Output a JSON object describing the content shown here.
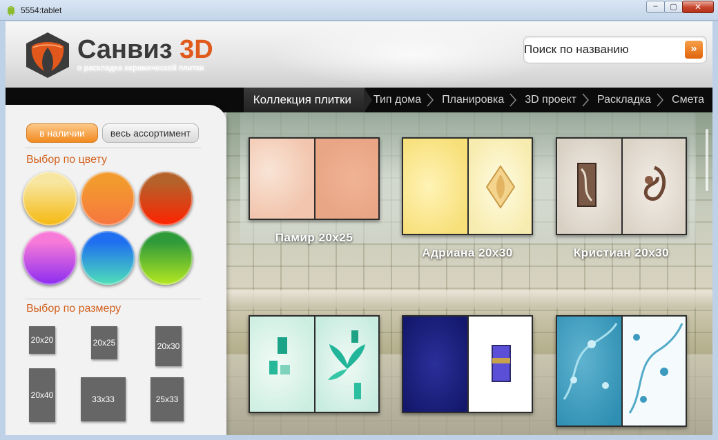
{
  "window": {
    "title": "5554:tablet",
    "min_glyph": "–",
    "max_glyph": "▢",
    "close_glyph": "✕"
  },
  "brand": {
    "name": "Санвиз",
    "suffix": "3D",
    "tagline": "о раскладка керамической плитки"
  },
  "search": {
    "placeholder": "Поиск по названию",
    "button_glyph": "»"
  },
  "nav": {
    "steps": [
      {
        "label": "Коллекция плитки",
        "active": true
      },
      {
        "label": "Тип дома",
        "active": false
      },
      {
        "label": "Планировка",
        "active": false
      },
      {
        "label": "3D проект",
        "active": false
      },
      {
        "label": "Раскладка",
        "active": false
      },
      {
        "label": "Смета",
        "active": false
      }
    ]
  },
  "filters": {
    "in_stock_label": "в наличии",
    "all_label": "весь ассортимент",
    "color_title": "Выбор по цвету",
    "size_title": "Выбор по размеру",
    "colors": [
      {
        "name": "yellow",
        "top": "#f7e6a0",
        "bottom": "#f5b80e"
      },
      {
        "name": "orange",
        "top": "#f29a2e",
        "bottom": "#f7763f"
      },
      {
        "name": "red",
        "top": "#b5612a",
        "bottom": "#ff2200"
      },
      {
        "name": "magenta",
        "top": "#f77ad8",
        "bottom": "#8b2cf0"
      },
      {
        "name": "blue-cyan",
        "top": "#1f6ff0",
        "bottom": "#4fe0b8"
      },
      {
        "name": "green",
        "top": "#2f9a3a",
        "bottom": "#b5e820"
      }
    ],
    "sizes": [
      "20x20",
      "20x25",
      "20x30",
      "20x40",
      "33x33",
      "25x33"
    ]
  },
  "tiles": [
    {
      "name": "Памир  20x25"
    },
    {
      "name": "Адриана  20x30"
    },
    {
      "name": "Кристиан  20x30"
    },
    {
      "name": ""
    },
    {
      "name": ""
    },
    {
      "name": ""
    }
  ]
}
